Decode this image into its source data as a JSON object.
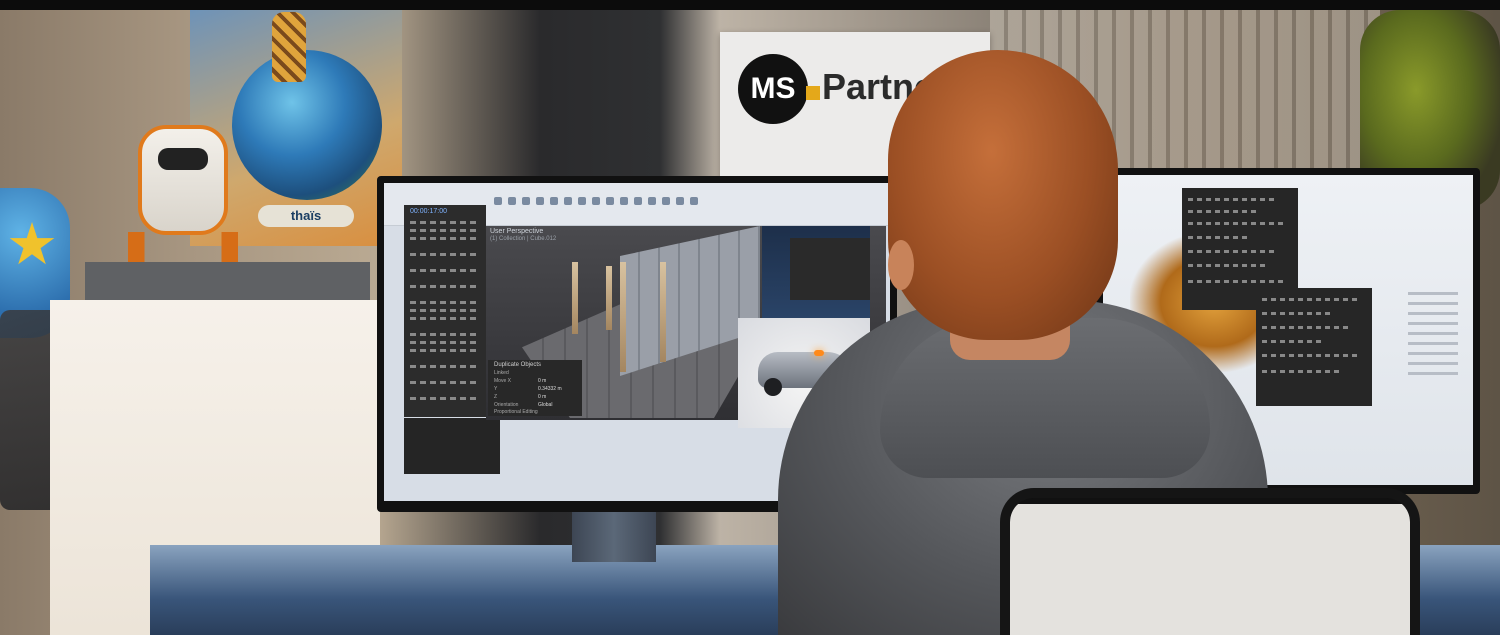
{
  "scene": {
    "sign_logo": "MS",
    "sign_word": "Partne",
    "poster_text": "thaïs"
  },
  "left_monitor": {
    "timecode": "00:00:17:00",
    "viewport_title": "User Perspective",
    "viewport_subtitle": "(1) Collection | Cube.012",
    "panel_title": "Duplicate Objects",
    "panel_rows": [
      "Linked",
      "Move X",
      "Y",
      "Z",
      "Orientation",
      "Proportional Editing"
    ],
    "panel_values": [
      "0 m",
      "0.34332 m",
      "0 m",
      "Global"
    ]
  },
  "colors": {
    "hair": "#9b4f24",
    "hoodie": "#55575b",
    "car_light": "#ff8a1a",
    "sign_accent": "#e4a81a"
  }
}
